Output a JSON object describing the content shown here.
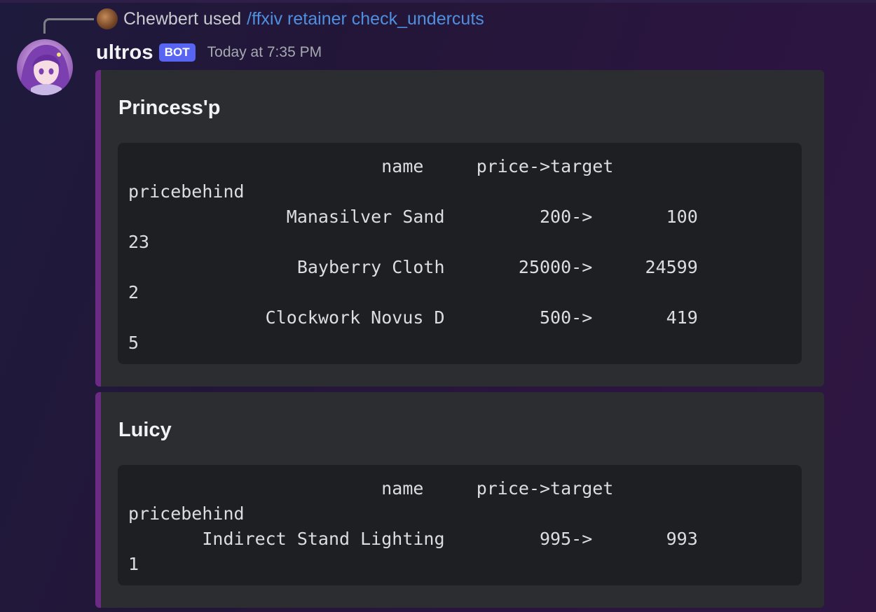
{
  "reply": {
    "user": "Chewbert",
    "used_text": "used",
    "command": "/ffxiv retainer check_undercuts"
  },
  "message": {
    "username": "ultros",
    "badge": "BOT",
    "timestamp": "Today at 7:35 PM"
  },
  "embeds": [
    {
      "title": "Princess'p",
      "lines": [
        "                        name     price->target",
        "pricebehind",
        "               Manasilver Sand         200->       100",
        "23",
        "                Bayberry Cloth       25000->     24599",
        "2",
        "             Clockwork Novus D         500->       419",
        "5"
      ]
    },
    {
      "title": "Luicy",
      "lines": [
        "                        name     price->target",
        "pricebehind",
        "       Indirect Stand Lighting         995->       993",
        "1"
      ]
    }
  ],
  "colors": {
    "accent_bar": "#6b2a83",
    "bot_badge": "#5865f2",
    "command_link": "#4f8fe0"
  }
}
